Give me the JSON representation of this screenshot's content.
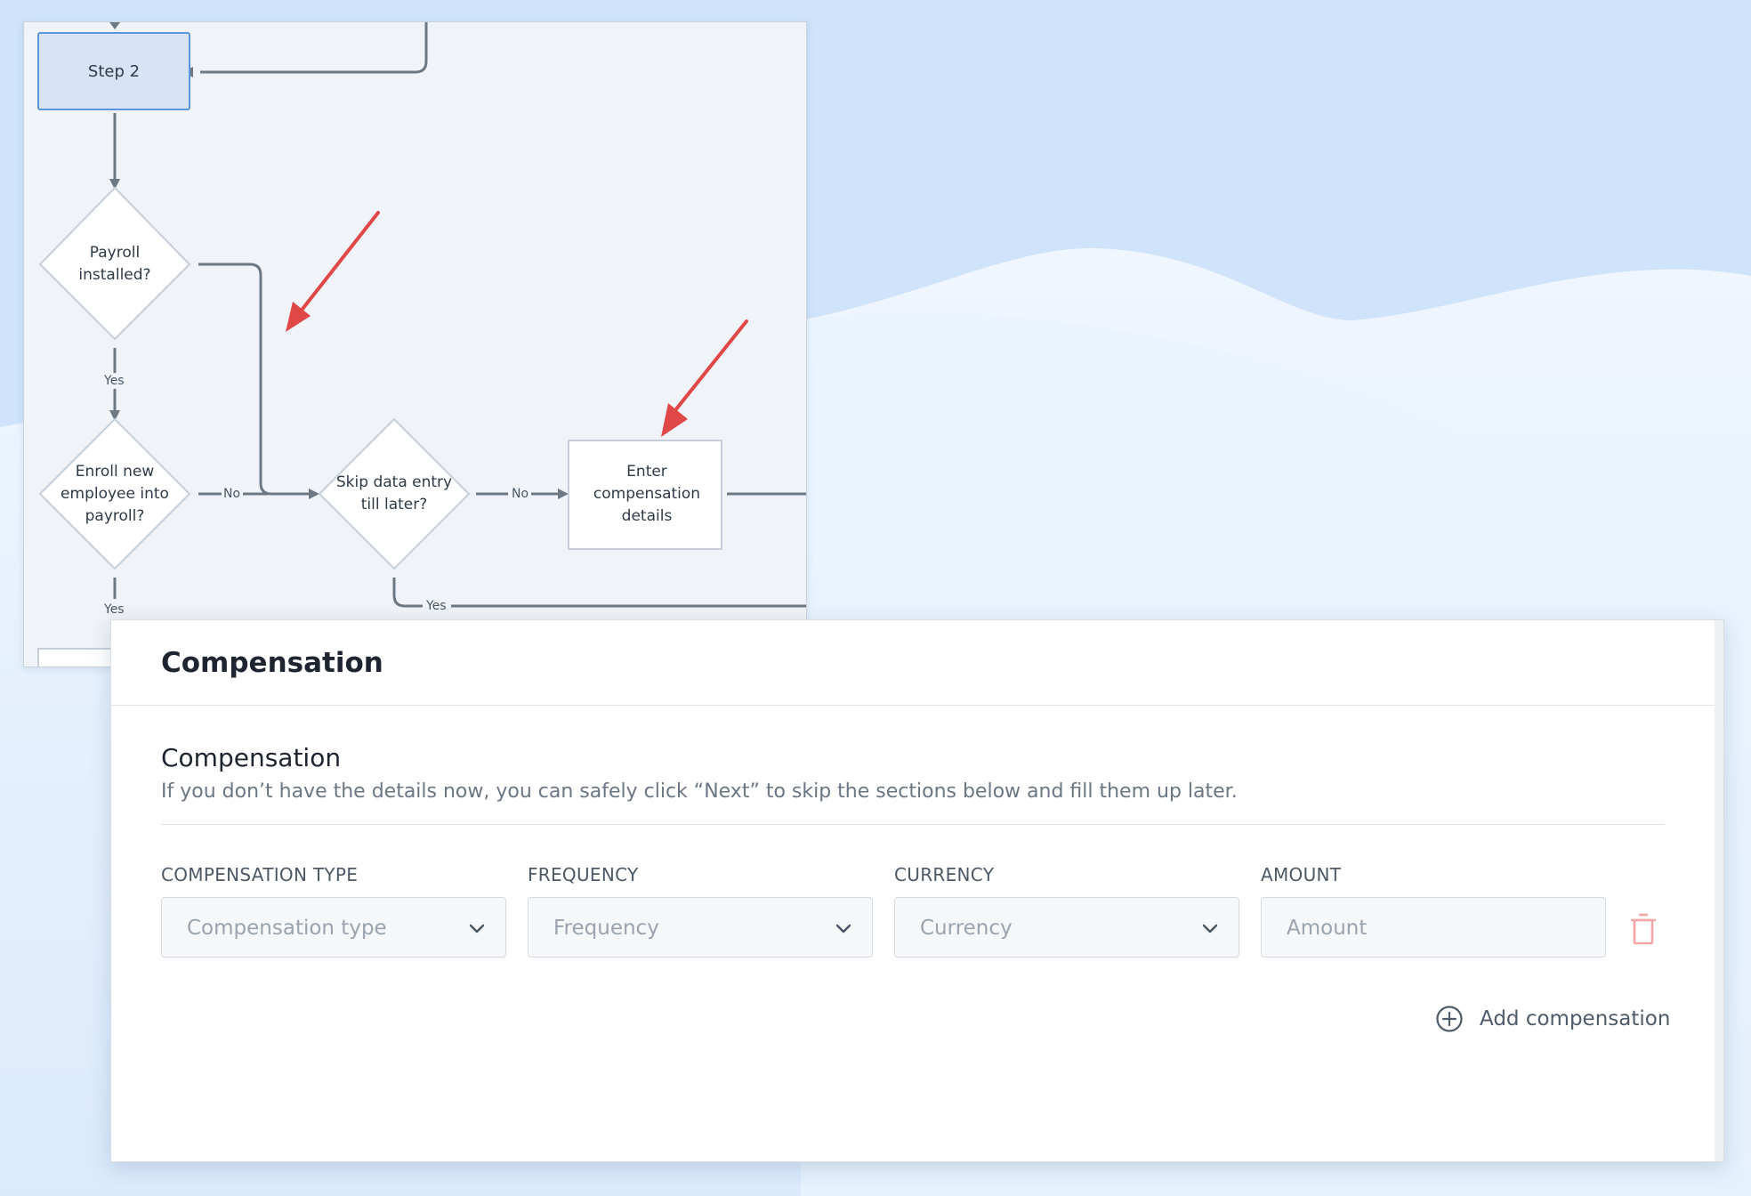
{
  "flowchart": {
    "step2_label": "Step 2",
    "payroll_installed": "Payroll installed?",
    "enroll_employee": "Enroll new employee into payroll?",
    "skip_data_entry": "Skip data entry till later?",
    "enter_compensation": "Enter compensation details",
    "edge_yes_1": "Yes",
    "edge_yes_2": "Yes",
    "edge_yes_3": "Yes",
    "edge_no_1": "No",
    "edge_no_2": "No"
  },
  "compensation_card": {
    "header_title": "Compensation",
    "section_title": "Compensation",
    "section_description": "If you don’t have the details now, you can safely click “Next” to skip the sections below and fill them up later.",
    "fields": [
      {
        "label": "COMPENSATION TYPE",
        "placeholder": "Compensation type",
        "kind": "select"
      },
      {
        "label": "FREQUENCY",
        "placeholder": "Frequency",
        "kind": "select"
      },
      {
        "label": "CURRENCY",
        "placeholder": "Currency",
        "kind": "select"
      },
      {
        "label": "AMOUNT",
        "placeholder": "Amount",
        "kind": "input"
      }
    ],
    "add_button_label": "Add compensation"
  },
  "colors": {
    "background": "#cfe3fb",
    "annotation_arrow": "#e04848",
    "step_box_fill": "#d6e4f5",
    "step_box_border": "#5b95dd",
    "trash_icon": "#f2a6a6"
  },
  "icons": {
    "dropdown": "chevron-down-icon",
    "delete": "trash-icon",
    "add": "plus-circle-icon",
    "annotation": "red-arrow-icon"
  }
}
